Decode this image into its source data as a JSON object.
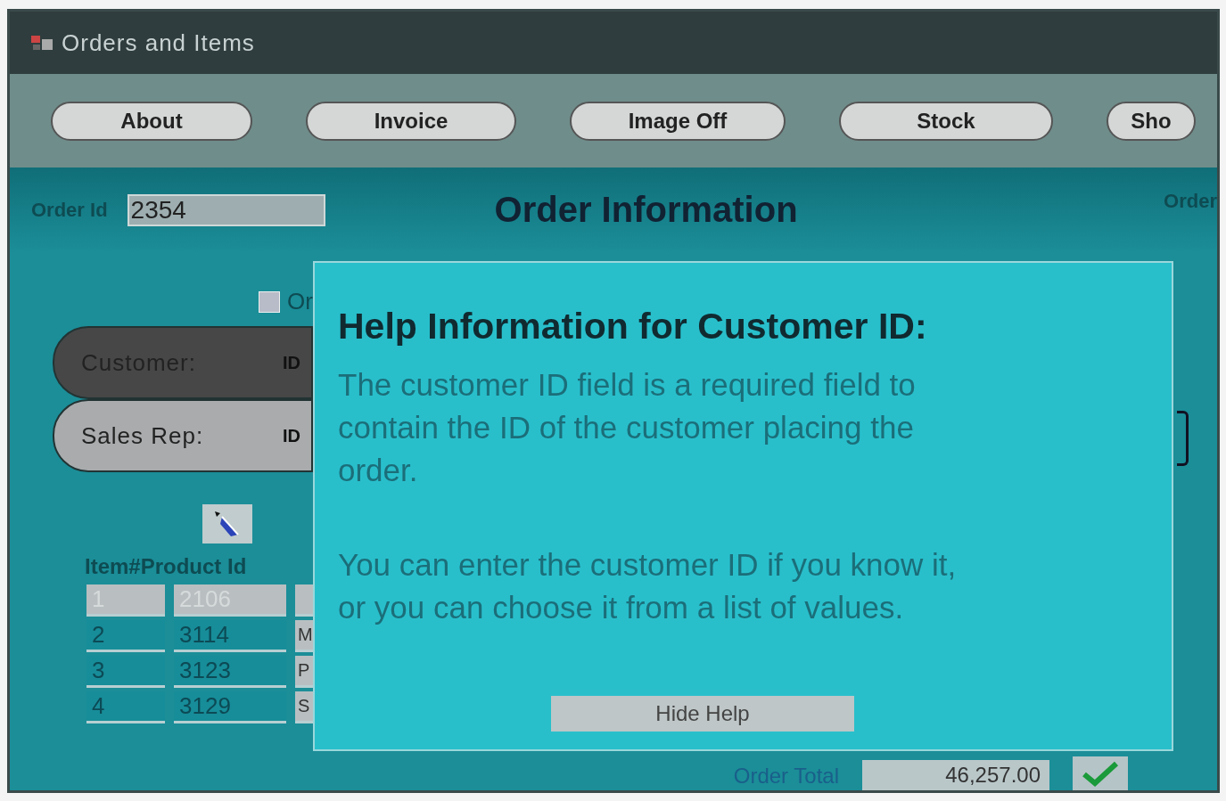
{
  "window": {
    "title": "Orders and Items"
  },
  "toolbar": {
    "buttons": [
      "About",
      "Invoice",
      "Image Off",
      "Stock",
      "Sho"
    ]
  },
  "header": {
    "order_id_label": "Order Id",
    "order_id_value": "2354",
    "title": "Order Information",
    "right_label": "Order"
  },
  "checkbox": {
    "label": "Or",
    "checked": false
  },
  "customer": {
    "label": "Customer:",
    "id_label": "ID",
    "selected": true
  },
  "sales_rep": {
    "label": "Sales Rep:",
    "id_label": "ID",
    "selected": false
  },
  "items": {
    "header": "Item#Product Id",
    "rows": [
      {
        "item": "1",
        "product": "2106",
        "column_3": "",
        "selected": true
      },
      {
        "item": "2",
        "product": "3114",
        "column_3": "M",
        "selected": false
      },
      {
        "item": "3",
        "product": "3123",
        "column_3": "P",
        "selected": false
      },
      {
        "item": "4",
        "product": "3129",
        "column_3": "S",
        "selected": false
      }
    ]
  },
  "help": {
    "title": "Help Information for Customer ID:",
    "paragraphs": [
      "The customer ID field is a required field to contain the ID of the customer placing the order.",
      "You can enter the customer ID if you know it, or you can choose it from a list of values."
    ],
    "button": "Hide Help"
  },
  "footer": {
    "total_label": "Order Total",
    "total_value": "46,257.00"
  }
}
